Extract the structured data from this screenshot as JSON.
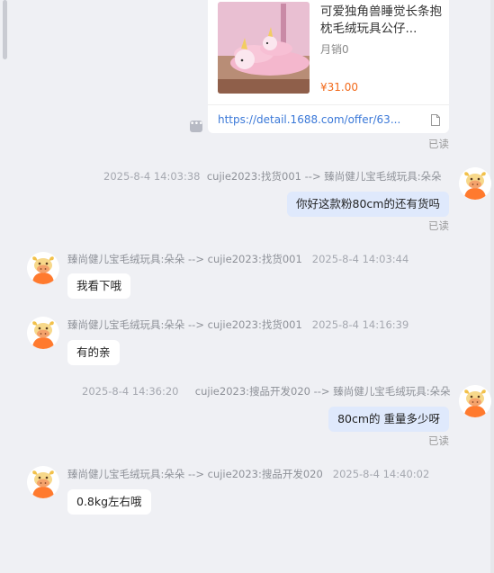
{
  "product_card": {
    "title": "可爱独角兽睡觉长条抱枕毛绒玩具公仔...",
    "sales": "月销0",
    "price": "¥31.00",
    "link": "https://detail.1688.com/offer/63...",
    "read_status": "已读"
  },
  "messages": [
    {
      "direction": "out",
      "time": "2025-8-4 14:03:38",
      "route": "cujie2023:找货001 --> 臻尚健儿宝毛绒玩具:朵朵",
      "text": "你好这款粉80cm的还有货吗",
      "read_status": "已读"
    },
    {
      "direction": "in",
      "route": "臻尚健儿宝毛绒玩具:朵朵 --> cujie2023:找货001",
      "time": "2025-8-4 14:03:44",
      "text": "我看下哦"
    },
    {
      "direction": "in",
      "route": "臻尚健儿宝毛绒玩具:朵朵 --> cujie2023:找货001",
      "time": "2025-8-4 14:16:39",
      "text": "有的亲"
    },
    {
      "direction": "out",
      "time": "2025-8-4 14:36:20",
      "route": "cujie2023:搜品开发020 --> 臻尚健儿宝毛绒玩具:朵朵",
      "text": "80cm的  重量多少呀",
      "read_status": "已读"
    },
    {
      "direction": "in",
      "route": "臻尚健儿宝毛绒玩具:朵朵 --> cujie2023:搜品开发020",
      "time": "2025-8-4 14:40:02",
      "text": "0.8kg左右哦"
    }
  ],
  "colors": {
    "background": "#eff0f4",
    "bubble_in": "#ffffff",
    "bubble_out": "#dfe9fc",
    "price": "#f26a1b",
    "link": "#3a78d8",
    "avatar_accent": "#ff7a2e"
  },
  "icons": {
    "avatar": "ox-avatar-icon",
    "more": "more-dots-icon",
    "doc": "document-icon"
  }
}
